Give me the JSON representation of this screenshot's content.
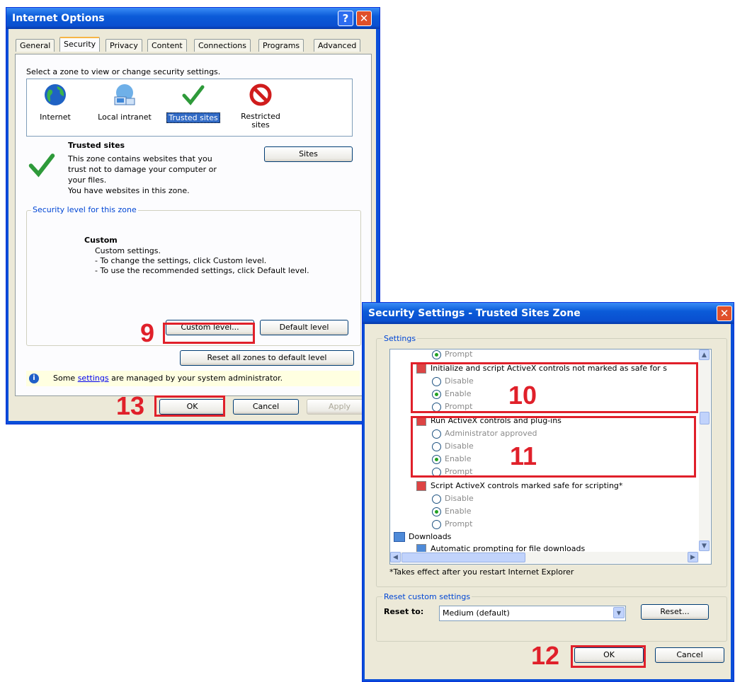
{
  "internet_options": {
    "title": "Internet Options",
    "help_glyph": "?",
    "close_glyph": "✕",
    "tabs": [
      "General",
      "Security",
      "Privacy",
      "Content",
      "Connections",
      "Programs",
      "Advanced"
    ],
    "zone_prompt": "Select a zone to view or change security settings.",
    "zones": [
      {
        "label": "Internet",
        "icon": "globe-icon"
      },
      {
        "label": "Local intranet",
        "icon": "intranet-icon"
      },
      {
        "label": "Trusted sites",
        "icon": "checkmark-icon"
      },
      {
        "label": "Restricted sites",
        "icon": "no-entry-icon"
      }
    ],
    "zone_title": "Trusted sites",
    "zone_desc_1": "This zone contains websites that you",
    "zone_desc_2": "trust not to damage your computer or",
    "zone_desc_3": "your files.",
    "zone_desc_4": "You have websites in this zone.",
    "sites_button": "Sites",
    "level_group_title": "Security level for this zone",
    "level_name": "Custom",
    "level_line_1": "Custom settings.",
    "level_line_2": "- To change the settings, click Custom level.",
    "level_line_3": "- To use the recommended settings, click Default level.",
    "custom_level_button": "Custom level...",
    "default_level_button": "Default level",
    "reset_all_button": "Reset all zones to default level",
    "info_before": "Some ",
    "info_link": "settings",
    "info_after": " are managed by your system administrator.",
    "ok": "OK",
    "cancel": "Cancel",
    "apply": "Apply"
  },
  "security_settings": {
    "title": "Security Settings - Trusted Sites Zone",
    "close_glyph": "✕",
    "settings_label": "Settings",
    "rows": {
      "r0": "Prompt",
      "r1": "Initialize and script ActiveX controls not marked as safe for s",
      "r2": "Disable",
      "r3": "Enable",
      "r4": "Prompt",
      "r5": "Run ActiveX controls and plug-ins",
      "r6": "Administrator approved",
      "r7": "Disable",
      "r8": "Enable",
      "r9": "Prompt",
      "r10": "Script ActiveX controls marked safe for scripting*",
      "r11": "Disable",
      "r12": "Enable",
      "r13": "Prompt",
      "r14": "Downloads",
      "r15": "Automatic prompting for file downloads"
    },
    "note": "*Takes effect after you restart Internet Explorer",
    "reset_group_title": "Reset custom settings",
    "reset_to_label": "Reset to:",
    "reset_to_value": "Medium (default)",
    "reset_button": "Reset...",
    "ok": "OK",
    "cancel": "Cancel"
  },
  "annotations": {
    "n9": "9",
    "n10": "10",
    "n11": "11",
    "n12": "12",
    "n13": "13"
  },
  "colors": {
    "callout": "#e0202a",
    "title_bar": "#0a4fd8",
    "dialog_face": "#ece9d8"
  }
}
